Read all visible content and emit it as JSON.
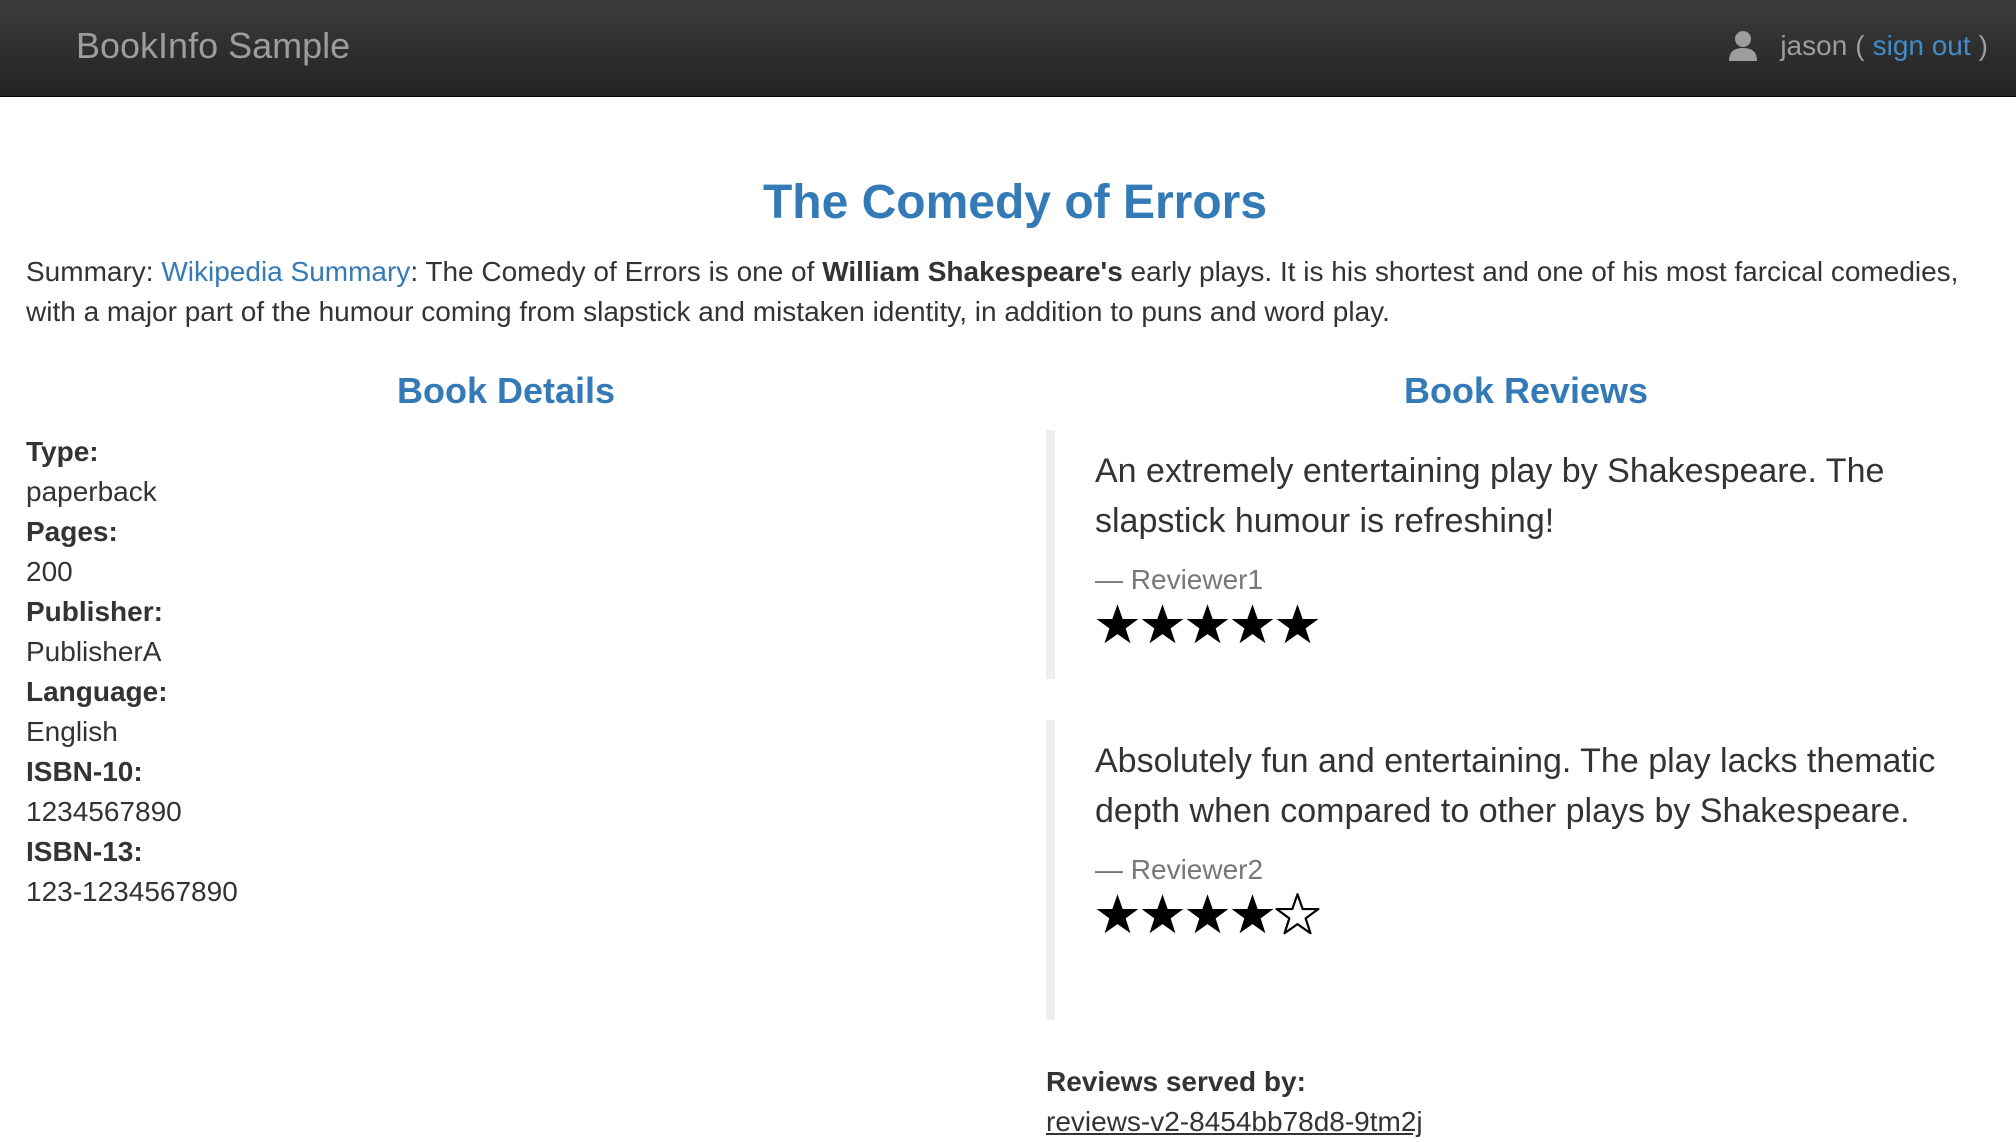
{
  "navbar": {
    "brand": "BookInfo Sample",
    "user": "jason",
    "open_paren": "(",
    "sign_out": "sign out",
    "close_paren": ")"
  },
  "product": {
    "title": "The Comedy of Errors",
    "summary_prefix": "Summary: ",
    "summary_link": "Wikipedia Summary",
    "summary_text_1": ": The Comedy of Errors is one of ",
    "summary_bold": "William Shakespeare's",
    "summary_text_2": " early plays. It is his shortest and one of his most farcical comedies, with a major part of the humour coming from slapstick and mistaken identity, in addition to puns and word play."
  },
  "details": {
    "heading": "Book Details",
    "items": [
      {
        "label": "Type:",
        "value": "paperback"
      },
      {
        "label": "Pages:",
        "value": "200"
      },
      {
        "label": "Publisher:",
        "value": "PublisherA"
      },
      {
        "label": "Language:",
        "value": "English"
      },
      {
        "label": "ISBN-10:",
        "value": "1234567890"
      },
      {
        "label": "ISBN-13:",
        "value": "123-1234567890"
      }
    ]
  },
  "reviews": {
    "heading": "Book Reviews",
    "items": [
      {
        "text": "An extremely entertaining play by Shakespeare. The slapstick humour is refreshing!",
        "reviewer": "— Reviewer1",
        "rating": 5,
        "max_rating": 5,
        "star_color": "#000000"
      },
      {
        "text": "Absolutely fun and entertaining. The play lacks thematic depth when compared to other plays by Shakespeare.",
        "reviewer": "— Reviewer2",
        "rating": 4,
        "max_rating": 5,
        "star_color": "#000000"
      }
    ],
    "served_by_label": "Reviews served by:",
    "served_by_value": "reviews-v2-8454bb78d8-9tm2j"
  },
  "colors": {
    "accent": "#337ab7",
    "link": "#428bca",
    "navbar_text": "#9d9d9d"
  },
  "icons": {
    "user": "user-icon",
    "star_filled": "star-filled-icon",
    "star_empty": "star-empty-icon"
  }
}
